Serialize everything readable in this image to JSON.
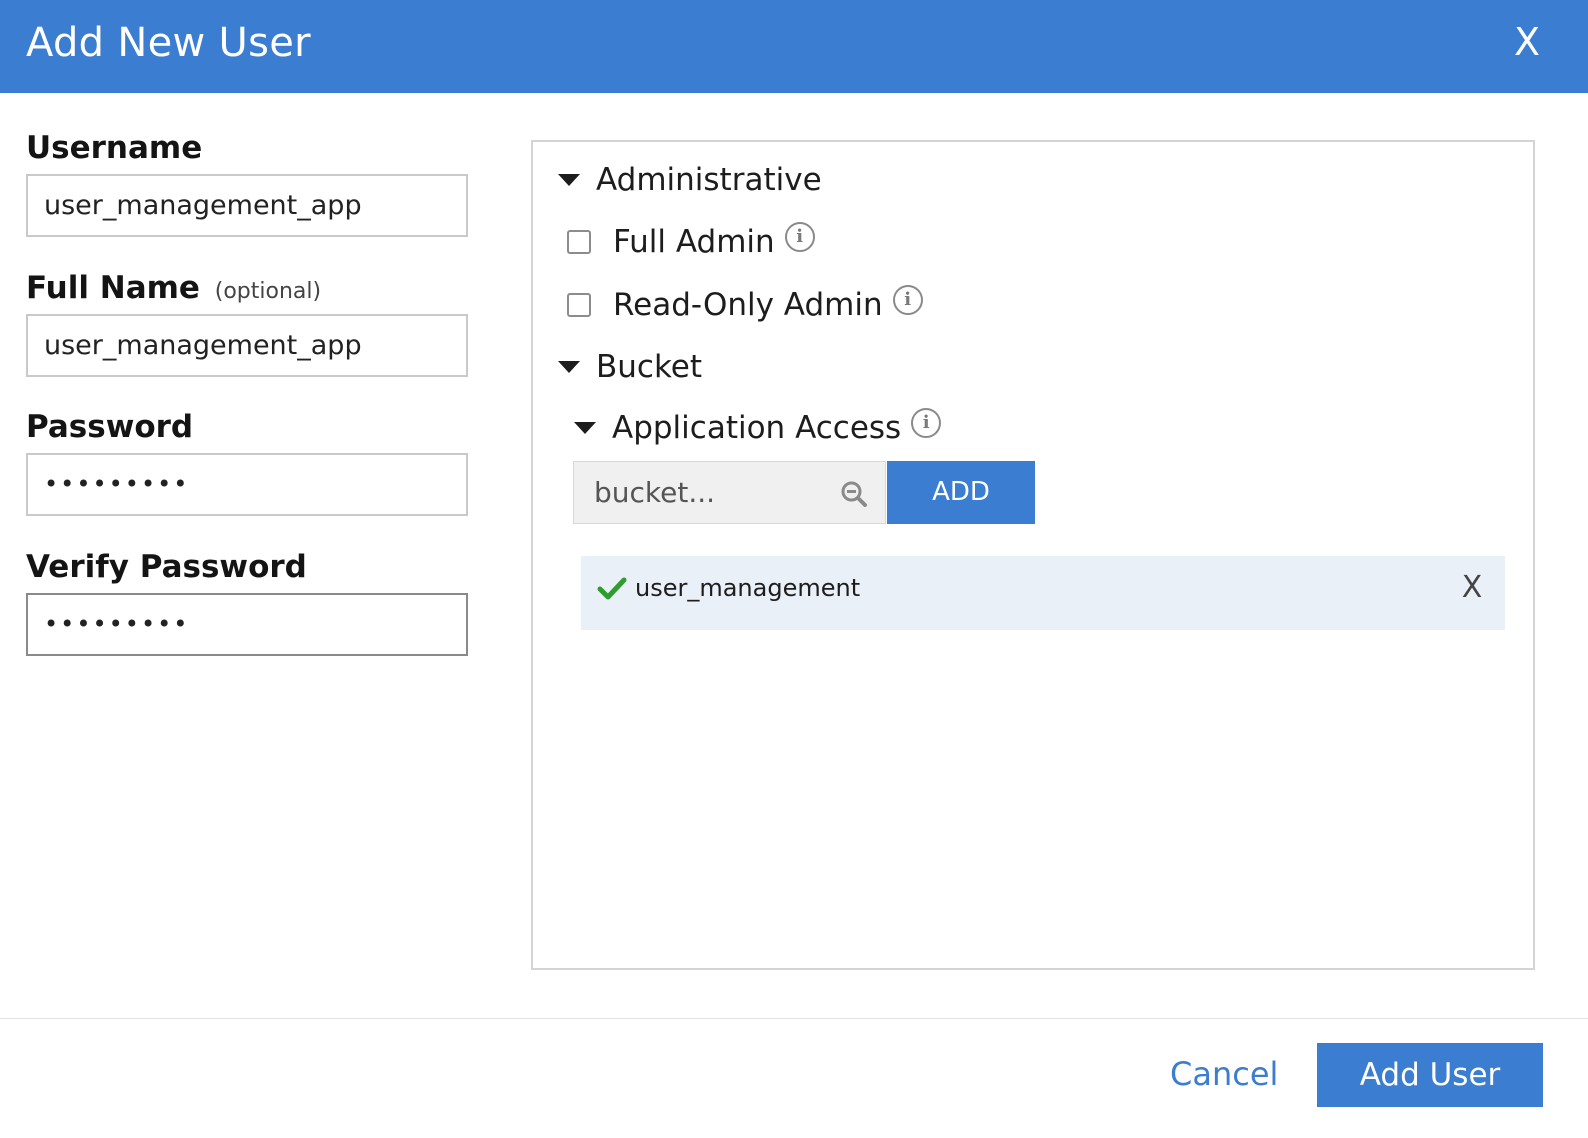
{
  "dialog": {
    "title": "Add New User",
    "close_label": "X"
  },
  "form": {
    "username": {
      "label": "Username",
      "value": "user_management_app"
    },
    "full_name": {
      "label": "Full Name",
      "optional_note": "(optional)",
      "value": "user_management_app"
    },
    "password": {
      "label": "Password",
      "value": "•••••••••"
    },
    "verify_password": {
      "label": "Verify Password",
      "value": "•••••••••"
    }
  },
  "permissions": {
    "administrative": {
      "title": "Administrative",
      "options": [
        {
          "label": "Full Admin",
          "checked": false
        },
        {
          "label": "Read-Only Admin",
          "checked": false
        }
      ]
    },
    "bucket": {
      "title": "Bucket",
      "application_access": {
        "title": "Application Access",
        "search_placeholder": "bucket...",
        "add_label": "ADD",
        "items": [
          {
            "name": "user_management",
            "remove_label": "X"
          }
        ]
      }
    },
    "info_glyph": "i"
  },
  "footer": {
    "cancel_label": "Cancel",
    "submit_label": "Add User"
  },
  "colors": {
    "accent": "#3b7dd1",
    "selected_row_bg": "#eaf0f7",
    "check_green": "#2e9d2e"
  }
}
